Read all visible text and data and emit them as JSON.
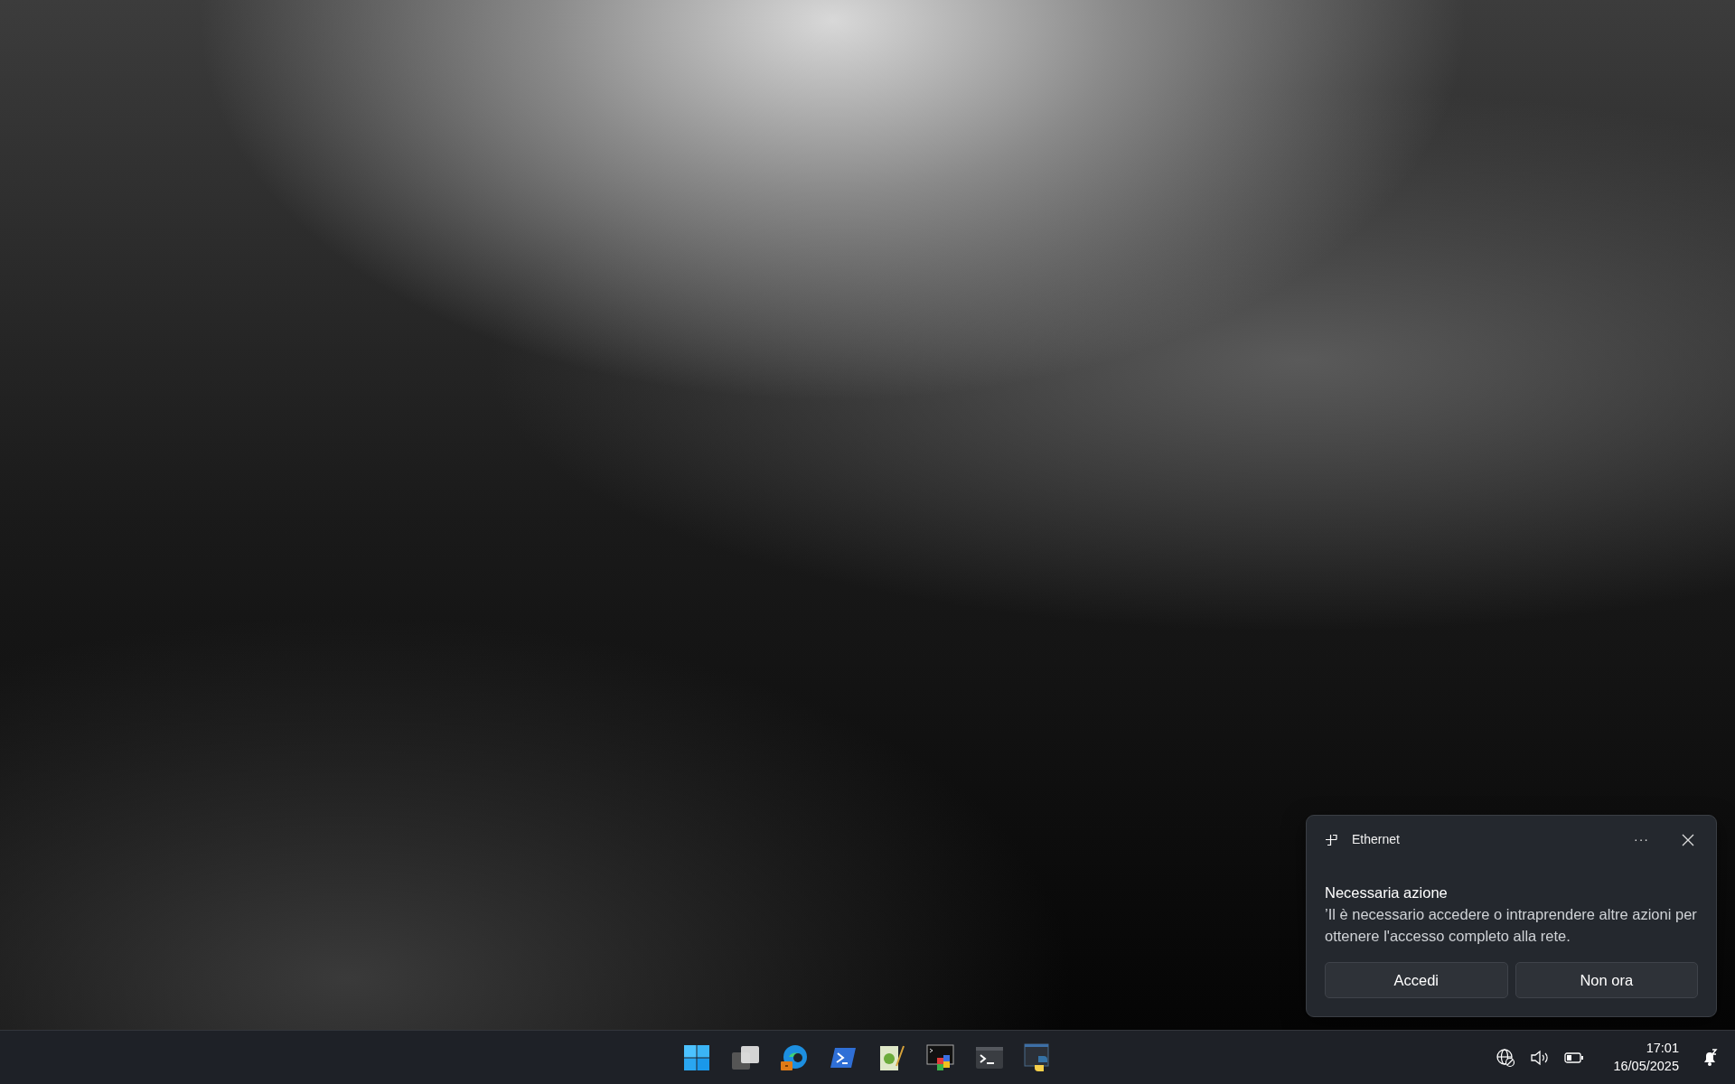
{
  "notification": {
    "app": "Ethernet",
    "more": "···",
    "title": "Necessaria azione",
    "body": "’Il è necessario accedere o intraprendere altre azioni per ottenere l'accesso completo alla rete.",
    "buttons": [
      "Accedi",
      "Non ora"
    ]
  },
  "clock": {
    "time": "17:01",
    "date": "16/05/2025"
  }
}
